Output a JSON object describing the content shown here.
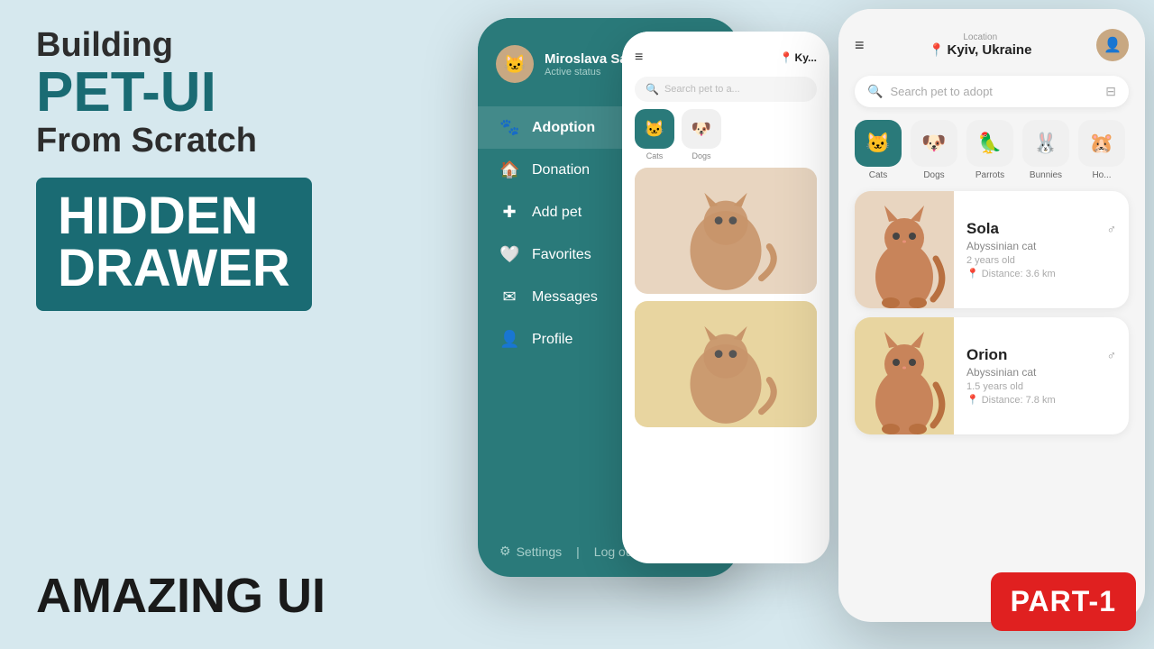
{
  "left": {
    "line1": "Building",
    "line2": "PET-UI",
    "line3": "From Scratch",
    "box_line1": "HIDDEN",
    "box_line2": "DRAWER",
    "bottom": "AMAZING UI"
  },
  "drawer_phone": {
    "user_name": "Miroslava Savitskaya",
    "user_status": "Active status",
    "menu_items": [
      {
        "label": "Adoption",
        "icon": "🐾",
        "active": true
      },
      {
        "label": "Donation",
        "icon": "🏠",
        "active": false
      },
      {
        "label": "Add pet",
        "icon": "➕",
        "active": false
      },
      {
        "label": "Favorites",
        "icon": "🤍",
        "active": false
      },
      {
        "label": "Messages",
        "icon": "✉️",
        "active": false
      },
      {
        "label": "Profile",
        "icon": "👤",
        "active": false
      }
    ],
    "footer_settings": "Settings",
    "footer_logout": "Log out"
  },
  "main_phone": {
    "location_label": "Location",
    "location_city": "Kyiv, Ukraine",
    "search_placeholder": "Search pet to adopt",
    "categories": [
      {
        "name": "Cats",
        "active": true
      },
      {
        "name": "Dogs",
        "active": false
      },
      {
        "name": "Parrots",
        "active": false
      },
      {
        "name": "Bunnies",
        "active": false
      },
      {
        "name": "Ho...",
        "active": false
      }
    ],
    "pets": [
      {
        "name": "Sola",
        "breed": "Abyssinian cat",
        "age": "2 years old",
        "distance": "Distance: 3.6 km",
        "gender": "♂"
      },
      {
        "name": "Orion",
        "breed": "Abyssinian cat",
        "age": "1.5 years old",
        "distance": "Distance: 7.8 km",
        "gender": "♂"
      }
    ]
  },
  "part_badge": "PART-1"
}
